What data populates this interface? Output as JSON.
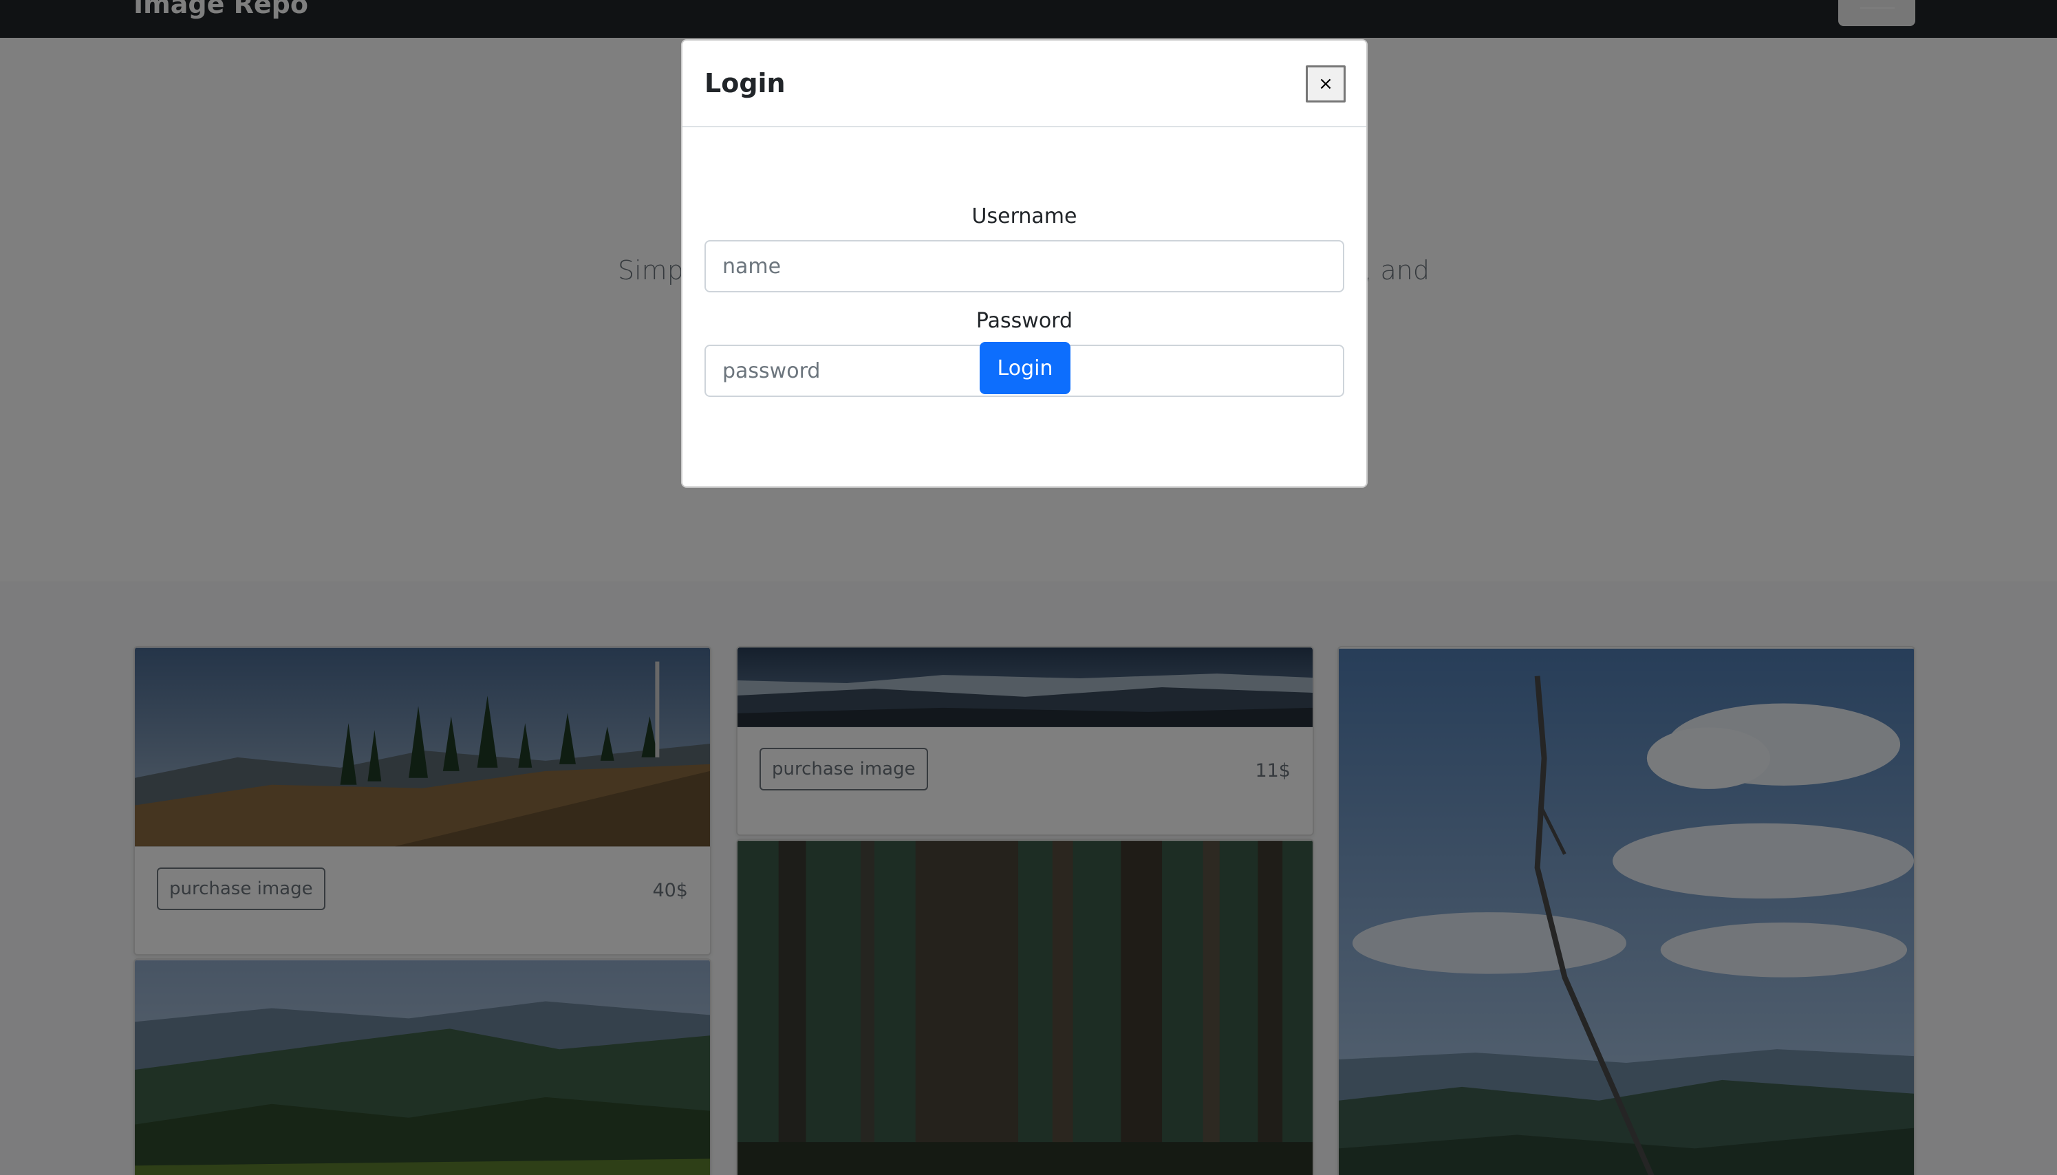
{
  "navbar": {
    "brand": "Image Repo"
  },
  "hero": {
    "title": "",
    "lead_left": "Simp",
    "lead_right": "o, and"
  },
  "cards": [
    {
      "button_label": "purchase image",
      "price": "40$"
    },
    {
      "button_label": "purchase image",
      "price": "11$"
    }
  ],
  "login_modal": {
    "title": "Login",
    "close_label": "×",
    "username_label": "Username",
    "username_placeholder": "name",
    "username_value": "",
    "password_label": "Password",
    "password_placeholder": "password",
    "password_value": "",
    "submit_label": "Login"
  },
  "colors": {
    "navbar": "#212529",
    "primary": "#0d6efd",
    "secondary": "#6c757d",
    "backdrop": "rgba(0,0,0,0.5)"
  }
}
